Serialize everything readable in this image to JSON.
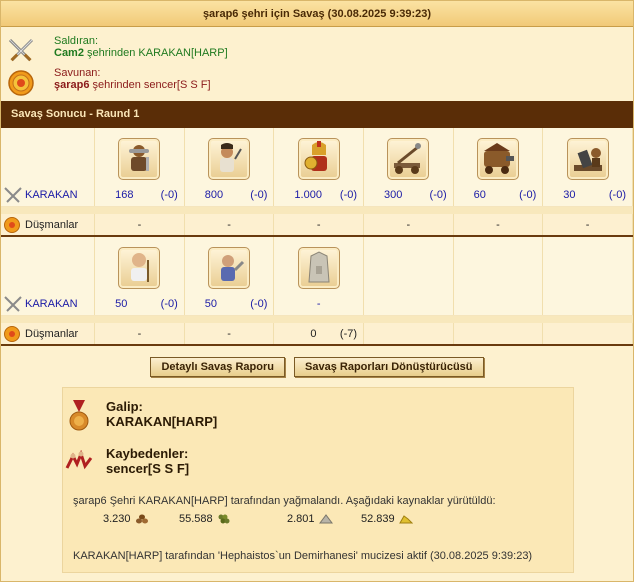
{
  "title": "şarap6 şehri için Savaş (30.08.2025 9:39:23)",
  "attacker": {
    "role_label": "Saldıran:",
    "city": "Cam2",
    "line_rest": " şehrinden KARAKAN[HARP]"
  },
  "defender": {
    "role_label": "Savunan:",
    "city": "şarap6",
    "line_rest": " şehrinden sencer[S S F]"
  },
  "result_bar": "Savaş Sonucu - Raund 1",
  "row1": {
    "units": [
      "swordsman-icon",
      "slinger-icon",
      "hoplite-icon",
      "catapult-icon",
      "ram-icon",
      "mortar-icon"
    ],
    "attacker_name": "KARAKAN",
    "attacker_counts": [
      {
        "n": "168",
        "d": "(-0)"
      },
      {
        "n": "800",
        "d": "(-0)"
      },
      {
        "n": "1.000",
        "d": "(-0)"
      },
      {
        "n": "300",
        "d": "(-0)"
      },
      {
        "n": "60",
        "d": "(-0)"
      },
      {
        "n": "30",
        "d": "(-0)"
      }
    ],
    "enemy_name": "Düşmanlar",
    "enemy_counts": [
      "-",
      "-",
      "-",
      "-",
      "-",
      "-"
    ]
  },
  "row2": {
    "units": [
      "doctor-icon",
      "cook-icon",
      "wall-icon"
    ],
    "attacker_name": "KARAKAN",
    "attacker_counts": [
      {
        "n": "50",
        "d": "(-0)"
      },
      {
        "n": "50",
        "d": "(-0)"
      },
      {
        "n": "-",
        "d": ""
      }
    ],
    "enemy_name": "Düşmanlar",
    "enemy_counts": [
      {
        "n": "-",
        "d": ""
      },
      {
        "n": "-",
        "d": ""
      },
      {
        "n": "0",
        "d": "(-7)"
      }
    ]
  },
  "buttons": {
    "report": "Detaylı Savaş Raporu",
    "converter": "Savaş Raporları Dönüştürücüsü"
  },
  "summary": {
    "winner_label": "Galip:",
    "winner": "KARAKAN[HARP]",
    "loser_label": "Kaybedenler:",
    "loser": "sencer[S S F]",
    "plunder_text": "şarap6 Şehri KARAKAN[HARP] tarafından yağmalandı. Aşağıdaki kaynaklar yürütüldü:",
    "resources": [
      {
        "value": "3.230",
        "icon": "wood-icon"
      },
      {
        "value": "55.588",
        "icon": "wine-icon"
      },
      {
        "value": "2.801",
        "icon": "marble-icon"
      },
      {
        "value": "52.839",
        "icon": "sulfur-icon"
      }
    ],
    "wonder_text": "KARAKAN[HARP] tarafından 'Hephaistos`un Demirhanesi' mucizesi aktif (30.08.2025 9:39:23)"
  },
  "colors": {
    "bar": "#5a2d07",
    "attacker_text": "#1f7a1f",
    "defender_text": "#8b1a1a",
    "count_blue": "#1a1aa6"
  }
}
